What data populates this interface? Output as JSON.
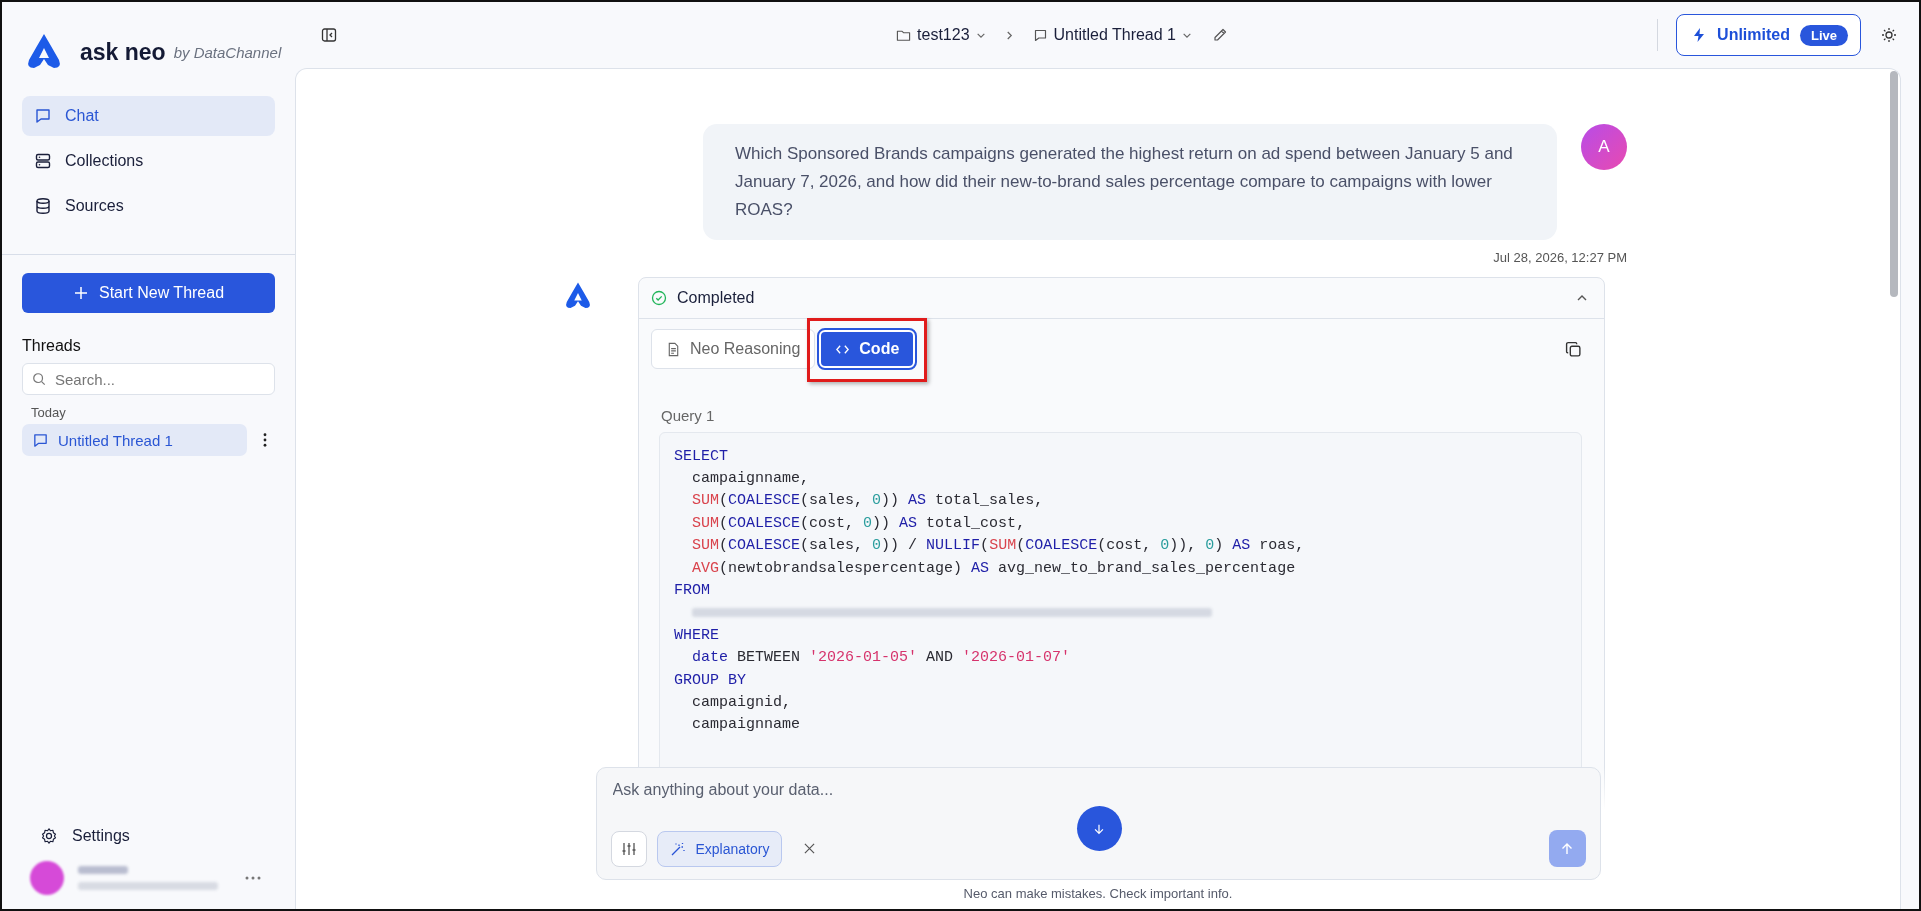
{
  "app": {
    "name": "ask neo",
    "byline": "by DataChannel"
  },
  "nav": [
    {
      "label": "Chat",
      "kind": "chat",
      "selected": true
    },
    {
      "label": "Collections",
      "kind": "collections",
      "selected": false
    },
    {
      "label": "Sources",
      "kind": "database",
      "selected": false
    }
  ],
  "new_thread_button": "Start New Thread",
  "threads": {
    "title": "Threads",
    "search_placeholder": "Search...",
    "groups": [
      {
        "label": "Today",
        "items": [
          {
            "label": "Untitled Thread 1",
            "selected": true
          }
        ]
      }
    ]
  },
  "settings": "Settings",
  "topbar": {
    "breadcrumb": [
      {
        "label": "test123",
        "kind": "folder"
      },
      {
        "label": "Untitled Thread 1",
        "kind": "thread"
      }
    ],
    "plan": {
      "label": "Unlimited",
      "badge": "Live"
    }
  },
  "messages": [
    {
      "avatar": "A",
      "text": "Which Sponsored Brands campaigns generated the highest return on ad spend between January 5 and January 7, 2026, and how did their new-to-brand sales percentage compare to campaigns with lower ROAS?",
      "time": "Jul 28, 2026, 12:27 PM"
    }
  ],
  "response": {
    "status": "Completed",
    "expanded": true,
    "tabs": [
      {
        "label": "Neo Reasoning",
        "kind": "reasoning",
        "selected": false
      },
      {
        "label": "Code",
        "kind": "code",
        "selected": true
      }
    ],
    "queries": [
      {
        "title": "Query 1",
        "lines": [
          {
            "tokens": [
              {
                "kind": "keyword",
                "text": "SELECT"
              }
            ]
          },
          {
            "tokens": [
              {
                "kind": "plain",
                "text": "  campaignname,"
              }
            ]
          },
          {
            "tokens": [
              {
                "kind": "function",
                "text": "  SUM"
              },
              {
                "kind": "plain",
                "text": "("
              },
              {
                "kind": "keyword",
                "text": "COALESCE"
              },
              {
                "kind": "plain",
                "text": "(sales, "
              },
              {
                "kind": "number",
                "text": "0"
              },
              {
                "kind": "plain",
                "text": ")) "
              },
              {
                "kind": "keyword",
                "text": "AS"
              },
              {
                "kind": "plain",
                "text": " total_sales,"
              }
            ]
          },
          {
            "tokens": [
              {
                "kind": "function",
                "text": "  SUM"
              },
              {
                "kind": "plain",
                "text": "("
              },
              {
                "kind": "keyword",
                "text": "COALESCE"
              },
              {
                "kind": "plain",
                "text": "(cost, "
              },
              {
                "kind": "number",
                "text": "0"
              },
              {
                "kind": "plain",
                "text": ")) "
              },
              {
                "kind": "keyword",
                "text": "AS"
              },
              {
                "kind": "plain",
                "text": " total_cost,"
              }
            ]
          },
          {
            "tokens": [
              {
                "kind": "function",
                "text": "  SUM"
              },
              {
                "kind": "plain",
                "text": "("
              },
              {
                "kind": "keyword",
                "text": "COALESCE"
              },
              {
                "kind": "plain",
                "text": "(sales, "
              },
              {
                "kind": "number",
                "text": "0"
              },
              {
                "kind": "plain",
                "text": ")) / "
              },
              {
                "kind": "keyword",
                "text": "NULLIF"
              },
              {
                "kind": "plain",
                "text": "("
              },
              {
                "kind": "function",
                "text": "SUM"
              },
              {
                "kind": "plain",
                "text": "("
              },
              {
                "kind": "keyword",
                "text": "COALESCE"
              },
              {
                "kind": "plain",
                "text": "(cost, "
              },
              {
                "kind": "number",
                "text": "0"
              },
              {
                "kind": "plain",
                "text": ")), "
              },
              {
                "kind": "number",
                "text": "0"
              },
              {
                "kind": "plain",
                "text": ") "
              },
              {
                "kind": "keyword",
                "text": "AS"
              },
              {
                "kind": "plain",
                "text": " roas,"
              }
            ]
          },
          {
            "tokens": [
              {
                "kind": "function",
                "text": "  AVG"
              },
              {
                "kind": "plain",
                "text": "(newtobrandsalespercentage) "
              },
              {
                "kind": "keyword",
                "text": "AS"
              },
              {
                "kind": "plain",
                "text": " avg_new_to_brand_sales_percentage"
              }
            ]
          },
          {
            "tokens": [
              {
                "kind": "keyword",
                "text": "FROM"
              }
            ]
          },
          {
            "tokens": [
              {
                "kind": "redacted"
              }
            ]
          },
          {
            "tokens": [
              {
                "kind": "keyword",
                "text": "WHERE"
              }
            ]
          },
          {
            "tokens": [
              {
                "kind": "keyword",
                "text": "  date"
              },
              {
                "kind": "plain",
                "text": " BETWEEN "
              },
              {
                "kind": "string",
                "text": "'2026-01-05'"
              },
              {
                "kind": "plain",
                "text": " AND "
              },
              {
                "kind": "string",
                "text": "'2026-01-07'"
              }
            ]
          },
          {
            "tokens": [
              {
                "kind": "keyword",
                "text": "GROUP BY"
              }
            ]
          },
          {
            "tokens": [
              {
                "kind": "plain",
                "text": "  campaignid,"
              }
            ]
          },
          {
            "tokens": [
              {
                "kind": "plain",
                "text": "  campaignname"
              }
            ]
          }
        ]
      }
    ]
  },
  "composer": {
    "placeholder": "Ask anything about your data...",
    "mode": {
      "label": "Explanatory"
    }
  },
  "footer": "Neo can make mistakes. Check important info."
}
